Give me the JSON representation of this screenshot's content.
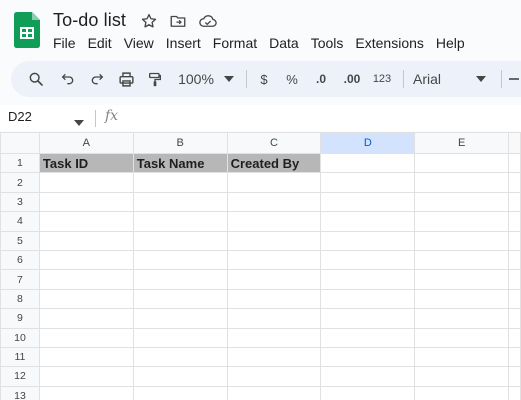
{
  "document": {
    "title": "To-do list"
  },
  "menu": [
    "File",
    "Edit",
    "View",
    "Insert",
    "Format",
    "Data",
    "Tools",
    "Extensions",
    "Help"
  ],
  "toolbar": {
    "zoom": "100%",
    "currency": "$",
    "percent": "%",
    "decrease_decimal": ".0",
    "increase_decimal": ".00",
    "number_format": "123",
    "font": "Arial"
  },
  "formula_bar": {
    "name_box": "D22",
    "fx": "fx",
    "value": ""
  },
  "grid": {
    "columns": [
      "A",
      "B",
      "C",
      "D",
      "E"
    ],
    "rows": [
      "1",
      "2",
      "3",
      "4",
      "5",
      "6",
      "7",
      "8",
      "9",
      "10",
      "11",
      "12",
      "13"
    ],
    "header_cells": [
      "Task ID",
      "Task Name",
      "Created By"
    ]
  },
  "colors": {
    "accent": "#0b57d0",
    "header_fill": "#b7b7b7",
    "selected_column": "#d3e3fd",
    "logo_green": "#0f9d58"
  },
  "icons": [
    "sheets-logo-icon",
    "star-icon",
    "move-folder-icon",
    "cloud-saved-icon",
    "search-icon",
    "undo-icon",
    "redo-icon",
    "print-icon",
    "paint-format-icon",
    "chevron-down-icon"
  ]
}
